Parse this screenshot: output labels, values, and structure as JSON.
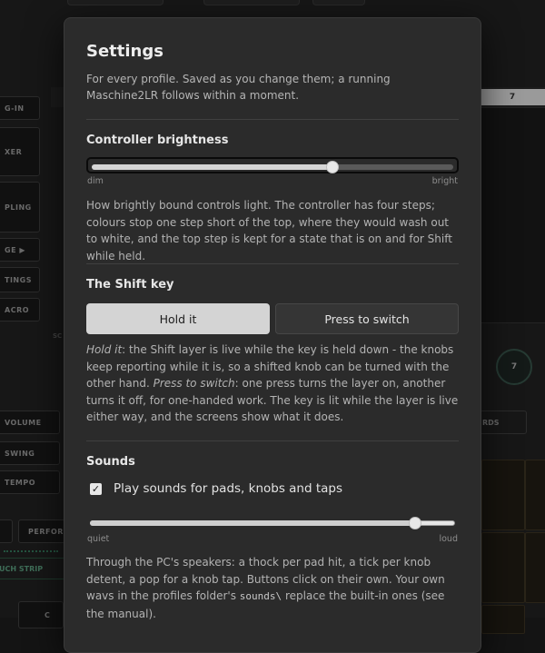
{
  "background": {
    "side_buttons": [
      "G-IN",
      "XER",
      "PLING",
      "GE ▶",
      "TINGS",
      "ACRO",
      "VOLUME",
      "SWING",
      "TEMPO",
      "PERFORM"
    ],
    "strip_label": "UCH STRIP",
    "tab_number": "7",
    "knob_number": "7",
    "right_button": "RDS",
    "bottom_label": "C",
    "screen_label": "SC"
  },
  "dialog": {
    "title": "Settings",
    "intro": "For every profile. Saved as you change them; a running Maschine2LR follows within a moment."
  },
  "brightness": {
    "title": "Controller brightness",
    "value_fraction": 0.66,
    "min_label": "dim",
    "max_label": "bright",
    "description": "How brightly bound controls light. The controller has four steps; colours stop one step short of the top, where they would wash out to white, and the top step is kept for a state that is on and for Shift while held."
  },
  "shift": {
    "title": "The Shift key",
    "options": [
      "Hold it",
      "Press to switch"
    ],
    "selected": "Hold it",
    "desc_hold_term": "Hold it",
    "desc_hold": ": the Shift layer is live while the key is held down - the knobs keep reporting while it is, so a shifted knob can be turned with the other hand. ",
    "desc_press_term": "Press to switch",
    "desc_press": ": one press turns the layer on, another turns it off, for one-handed work. The key is lit while the layer is live either way, and the screens show what it does."
  },
  "sounds": {
    "title": "Sounds",
    "checkbox_label": "Play sounds for pads, knobs and taps",
    "checked": true,
    "check_glyph": "✓",
    "volume_fraction": 0.89,
    "min_label": "quiet",
    "max_label": "loud",
    "desc_a": "Through the PC's speakers: a thock per pad hit, a tick per knob detent, a pop for a knob tap. Buttons click on their own. Your own wavs in the profiles folder's ",
    "desc_code": "sounds\\",
    "desc_b": " replace the built-in ones (see the manual)."
  }
}
